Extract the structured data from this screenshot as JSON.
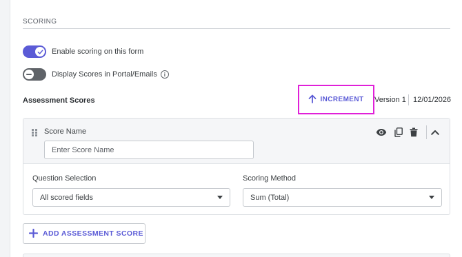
{
  "section": {
    "title": "SCORING"
  },
  "toggles": [
    {
      "label": "Enable scoring on this form",
      "state": "on"
    },
    {
      "label": "Display Scores in Portal/Emails",
      "state": "off",
      "info_icon": "info-icon"
    }
  ],
  "assessment": {
    "title": "Assessment Scores",
    "increment_label": "INCREMENT",
    "increment_icon": "arrow-up-icon",
    "version": "Version 1",
    "date": "12/01/2026"
  },
  "score_card": {
    "name_label": "Score Name",
    "name_placeholder": "Enter Score Name",
    "name_value": "",
    "action_icons": [
      "eye-icon",
      "copy-icon",
      "trash-icon",
      "chevron-up-icon"
    ],
    "question_selection": {
      "label": "Question Selection",
      "value": "All scored fields"
    },
    "scoring_method": {
      "label": "Scoring Method",
      "value": "Sum (Total)"
    }
  },
  "add_button": {
    "label": "ADD ASSESSMENT SCORE",
    "icon": "plus-icon"
  },
  "colors": {
    "accent": "#5b5bd6",
    "highlight": "#e020d8",
    "toggle_off": "#5f6368"
  }
}
